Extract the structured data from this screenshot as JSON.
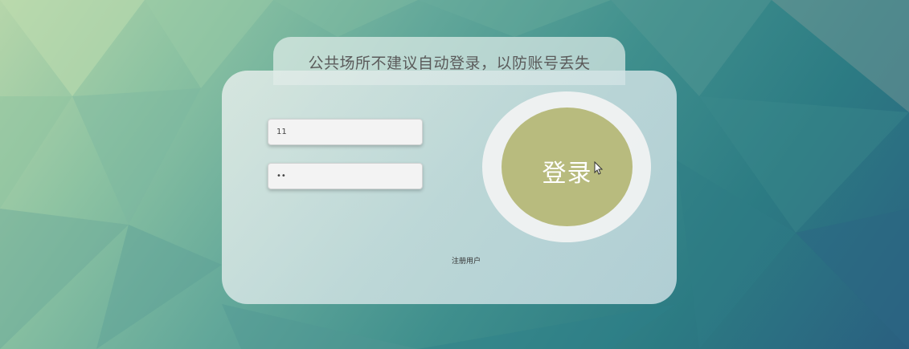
{
  "notice": {
    "text": "公共场所不建议自动登录，以防账号丢失"
  },
  "form": {
    "username_value": "11",
    "password_value": "11"
  },
  "login_button": {
    "label": "登录"
  },
  "register_link": {
    "label": "注册用户"
  },
  "colors": {
    "login_button": "#b8bb7e",
    "panel": "#d5e5e6"
  }
}
